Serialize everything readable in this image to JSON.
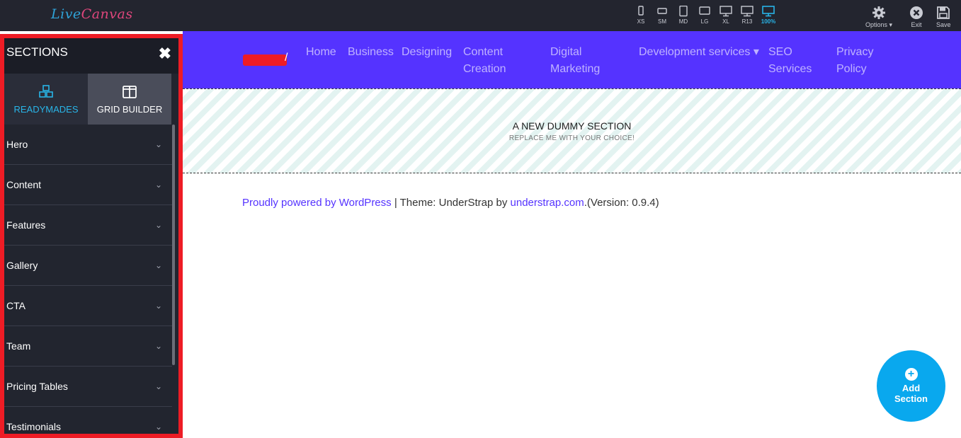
{
  "app": {
    "logo_part1": "Live",
    "logo_part2": "Canvas"
  },
  "toolbar": {
    "devices": [
      {
        "label": "XS",
        "icon": "phone-icon"
      },
      {
        "label": "SM",
        "icon": "phone-landscape-icon"
      },
      {
        "label": "MD",
        "icon": "tablet-icon"
      },
      {
        "label": "LG",
        "icon": "tablet-landscape-icon"
      },
      {
        "label": "XL",
        "icon": "desktop-icon"
      },
      {
        "label": "R13",
        "icon": "laptop-icon"
      },
      {
        "label": "100%",
        "icon": "monitor-icon",
        "active": true
      }
    ],
    "options_label": "Options ▾",
    "exit_label": "Exit",
    "save_label": "Save"
  },
  "sidebar": {
    "title": "SECTIONS",
    "tabs": [
      {
        "label": "READYMADES",
        "icon": "cubes-icon",
        "active": true
      },
      {
        "label": "GRID BUILDER",
        "icon": "columns-icon",
        "active": false
      }
    ],
    "items": [
      {
        "label": "Hero"
      },
      {
        "label": "Content"
      },
      {
        "label": "Features"
      },
      {
        "label": "Gallery"
      },
      {
        "label": "CTA"
      },
      {
        "label": "Team"
      },
      {
        "label": "Pricing Tables"
      },
      {
        "label": "Testimonials"
      }
    ]
  },
  "site_nav": {
    "brand_suffix": "/",
    "links": [
      {
        "label": "Home"
      },
      {
        "label": "Business"
      },
      {
        "label": "Designing"
      },
      {
        "label": "Content Creation"
      },
      {
        "label": "Digital Marketing"
      },
      {
        "label": "Development services ▾"
      },
      {
        "label": "SEO Services"
      },
      {
        "label": "Privacy Policy"
      }
    ]
  },
  "dummy_section": {
    "title": "A NEW DUMMY SECTION",
    "subtitle": "REPLACE ME WITH YOUR CHOICE!"
  },
  "footer": {
    "powered_link": "Proudly powered by WordPress",
    "separator": " | Theme: UnderStrap by ",
    "theme_link": "understrap.com",
    "version": ".(Version: 0.9.4)"
  },
  "add_section": {
    "label": "Add Section"
  },
  "colors": {
    "accent": "#5533ff",
    "highlight_border": "#ee1c25",
    "add_button": "#09a8ee",
    "active_tab": "#29b5e8"
  }
}
